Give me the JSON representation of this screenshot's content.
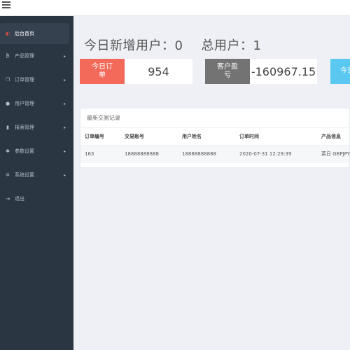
{
  "header": {
    "menu_icon": "hamburger-icon"
  },
  "sidebar": {
    "items": [
      {
        "label": "后台首页",
        "icon": "speedometer-icon",
        "icon_glyph": "◐",
        "has_arrow": false,
        "active": true
      },
      {
        "label": "产品管理",
        "icon": "bitcoin-icon",
        "icon_glyph": "₿",
        "has_arrow": true,
        "active": false
      },
      {
        "label": "订单管理",
        "icon": "copy-icon",
        "icon_glyph": "❐",
        "has_arrow": true,
        "active": false
      },
      {
        "label": "用户管理",
        "icon": "user-icon",
        "icon_glyph": "●",
        "has_arrow": true,
        "active": false
      },
      {
        "label": "报表管理",
        "icon": "bar-chart-icon",
        "icon_glyph": "▮",
        "has_arrow": true,
        "active": false
      },
      {
        "label": "参数设置",
        "icon": "gear-icon",
        "icon_glyph": "✱",
        "has_arrow": true,
        "active": false
      },
      {
        "label": "系统设置",
        "icon": "gears-icon",
        "icon_glyph": "✲",
        "has_arrow": true,
        "active": false
      },
      {
        "label": "退出",
        "icon": "sign-out-icon",
        "icon_glyph": "⇥",
        "has_arrow": false,
        "active": false
      }
    ],
    "arrow_glyph": "▸"
  },
  "stats": {
    "new_users_label": "今日新增用户：",
    "new_users_value": "0",
    "total_users_label": "总用户：",
    "total_users_value": "1"
  },
  "cards": [
    {
      "label": "今日订单",
      "value": "954",
      "color": "#f36a5a"
    },
    {
      "label": "客户盈亏",
      "value": "-160967.15",
      "color": "#737373"
    },
    {
      "label": "今日",
      "value": "",
      "color": "#5ac8f0"
    }
  ],
  "transactions": {
    "title": "最新交易记录",
    "columns": [
      "订单编号",
      "交易账号",
      "用户姓名",
      "订单时间",
      "产品信息"
    ],
    "rows": [
      [
        "163",
        "18888888888",
        "18888888888",
        "2020-07-31 12:29:39",
        "英日 GBPJPY"
      ]
    ]
  }
}
